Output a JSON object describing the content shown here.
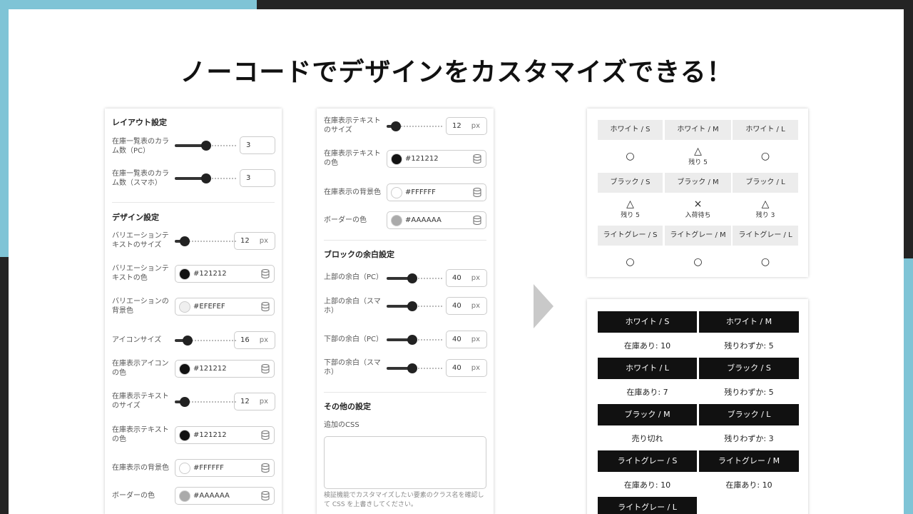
{
  "headline": "ノーコードでデザインをカスタマイズできる！",
  "panel_a": {
    "layout_title": "レイアウト設定",
    "columns_pc_label": "在庫一覧表のカラム数（PC）",
    "columns_pc_value": "3",
    "columns_pc_level": 0.5,
    "columns_sp_label": "在庫一覧表のカラム数（スマホ）",
    "columns_sp_value": "3",
    "columns_sp_level": 0.5,
    "design_title": "デザイン設定",
    "var_text_size_label": "バリエーションテキストのサイズ",
    "var_text_size_value": "12",
    "var_text_size_level": 0.1,
    "unit_px": "px",
    "var_text_color_label": "バリエーションテキストの色",
    "var_text_color_value": "#121212",
    "var_bg_label": "バリエーションの背景色",
    "var_bg_value": "#EFEFEF",
    "icon_size_label": "アイコンサイズ",
    "icon_size_value": "16",
    "icon_size_level": 0.15,
    "stock_icon_color_label": "在庫表示アイコンの色",
    "stock_icon_color_value": "#121212",
    "stock_text_size_label": "在庫表示テキストのサイズ",
    "stock_text_size_value": "12",
    "stock_text_size_level": 0.1,
    "stock_text_color_label": "在庫表示テキストの色",
    "stock_text_color_value": "#121212",
    "stock_bg_label": "在庫表示の背景色",
    "stock_bg_value": "#FFFFFF",
    "border_color_label": "ボーダーの色",
    "border_color_value": "#AAAAAA"
  },
  "panel_b": {
    "stock_text_size_label": "在庫表示テキストのサイズ",
    "stock_text_size_value": "12",
    "stock_text_size_level": 0.1,
    "unit_px": "px",
    "stock_text_color_label": "在庫表示テキストの色",
    "stock_text_color_value": "#121212",
    "stock_bg_label": "在庫表示の背景色",
    "stock_bg_value": "#FFFFFF",
    "border_color_label": "ボーダーの色",
    "border_color_value": "#AAAAAA",
    "margin_title": "ブロックの余白設定",
    "top_pc_label": "上部の余白（PC）",
    "top_pc_value": "40",
    "top_pc_level": 0.45,
    "top_sp_label": "上部の余白（スマホ）",
    "top_sp_value": "40",
    "top_sp_level": 0.45,
    "bottom_pc_label": "下部の余白（PC）",
    "bottom_pc_value": "40",
    "bottom_pc_level": 0.45,
    "bottom_sp_label": "下部の余白（スマホ）",
    "bottom_sp_value": "40",
    "bottom_sp_level": 0.45,
    "other_title": "その他の設定",
    "css_label": "追加のCSS",
    "css_note": "検証機能でカスタマイズしたい要素のクラス名を確認して CSS を上書きしてください。"
  },
  "colors": {
    "dark": "#121212",
    "light_gray": "#EFEFEF",
    "white": "#FFFFFF",
    "gray": "#AAAAAA",
    "bg_blue": "#7fc4d6",
    "bg_dark": "#242424"
  },
  "preview_compact": {
    "headers": [
      "ホワイト / S",
      "ホワイト / M",
      "ホワイト / L",
      "ブラック / S",
      "ブラック / M",
      "ブラック / L",
      "ライトグレー / S",
      "ライトグレー / M",
      "ライトグレー / L"
    ],
    "cells": [
      {
        "symbol": "○",
        "text": ""
      },
      {
        "symbol": "△",
        "text": "残り 5"
      },
      {
        "symbol": "○",
        "text": ""
      },
      {
        "symbol": "△",
        "text": "残り 5"
      },
      {
        "symbol": "×",
        "text": "入荷待ち"
      },
      {
        "symbol": "△",
        "text": "残り 3"
      },
      {
        "symbol": "○",
        "text": ""
      },
      {
        "symbol": "○",
        "text": ""
      },
      {
        "symbol": "○",
        "text": ""
      }
    ]
  },
  "preview_detailed": {
    "headers": [
      "ホワイト / S",
      "ホワイト / M",
      "ホワイト / L",
      "ブラック / S",
      "ブラック / M",
      "ブラック / L",
      "ライトグレー / S",
      "ライトグレー / M",
      "ライトグレー / L"
    ],
    "values": [
      "在庫あり: 10",
      "残りわずか: 5",
      "在庫あり: 7",
      "残りわずか: 5",
      "売り切れ",
      "残りわずか: 3",
      "在庫あり: 10",
      "在庫あり: 10"
    ]
  }
}
